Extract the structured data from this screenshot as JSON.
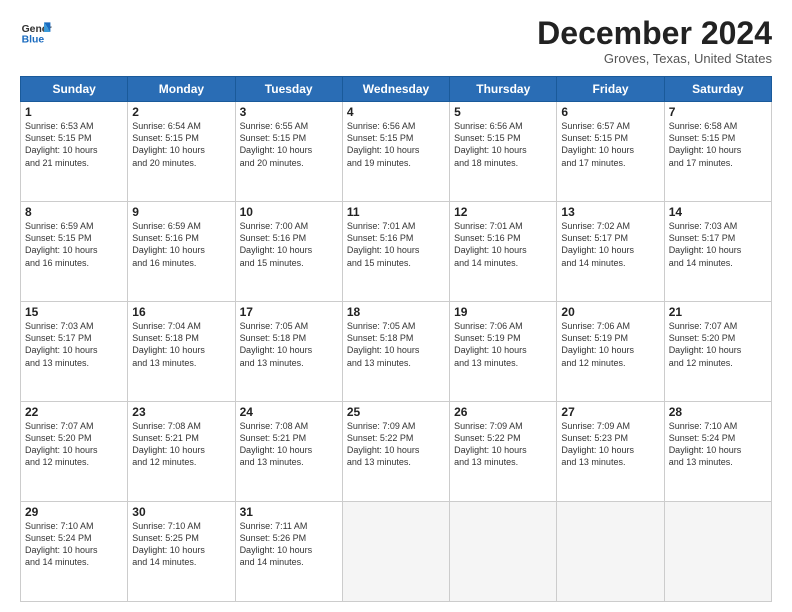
{
  "logo": {
    "line1": "General",
    "line2": "Blue"
  },
  "title": "December 2024",
  "location": "Groves, Texas, United States",
  "days_of_week": [
    "Sunday",
    "Monday",
    "Tuesday",
    "Wednesday",
    "Thursday",
    "Friday",
    "Saturday"
  ],
  "weeks": [
    [
      {
        "day": "1",
        "info": "Sunrise: 6:53 AM\nSunset: 5:15 PM\nDaylight: 10 hours\nand 21 minutes."
      },
      {
        "day": "2",
        "info": "Sunrise: 6:54 AM\nSunset: 5:15 PM\nDaylight: 10 hours\nand 20 minutes."
      },
      {
        "day": "3",
        "info": "Sunrise: 6:55 AM\nSunset: 5:15 PM\nDaylight: 10 hours\nand 20 minutes."
      },
      {
        "day": "4",
        "info": "Sunrise: 6:56 AM\nSunset: 5:15 PM\nDaylight: 10 hours\nand 19 minutes."
      },
      {
        "day": "5",
        "info": "Sunrise: 6:56 AM\nSunset: 5:15 PM\nDaylight: 10 hours\nand 18 minutes."
      },
      {
        "day": "6",
        "info": "Sunrise: 6:57 AM\nSunset: 5:15 PM\nDaylight: 10 hours\nand 17 minutes."
      },
      {
        "day": "7",
        "info": "Sunrise: 6:58 AM\nSunset: 5:15 PM\nDaylight: 10 hours\nand 17 minutes."
      }
    ],
    [
      {
        "day": "8",
        "info": "Sunrise: 6:59 AM\nSunset: 5:15 PM\nDaylight: 10 hours\nand 16 minutes."
      },
      {
        "day": "9",
        "info": "Sunrise: 6:59 AM\nSunset: 5:16 PM\nDaylight: 10 hours\nand 16 minutes."
      },
      {
        "day": "10",
        "info": "Sunrise: 7:00 AM\nSunset: 5:16 PM\nDaylight: 10 hours\nand 15 minutes."
      },
      {
        "day": "11",
        "info": "Sunrise: 7:01 AM\nSunset: 5:16 PM\nDaylight: 10 hours\nand 15 minutes."
      },
      {
        "day": "12",
        "info": "Sunrise: 7:01 AM\nSunset: 5:16 PM\nDaylight: 10 hours\nand 14 minutes."
      },
      {
        "day": "13",
        "info": "Sunrise: 7:02 AM\nSunset: 5:17 PM\nDaylight: 10 hours\nand 14 minutes."
      },
      {
        "day": "14",
        "info": "Sunrise: 7:03 AM\nSunset: 5:17 PM\nDaylight: 10 hours\nand 14 minutes."
      }
    ],
    [
      {
        "day": "15",
        "info": "Sunrise: 7:03 AM\nSunset: 5:17 PM\nDaylight: 10 hours\nand 13 minutes."
      },
      {
        "day": "16",
        "info": "Sunrise: 7:04 AM\nSunset: 5:18 PM\nDaylight: 10 hours\nand 13 minutes."
      },
      {
        "day": "17",
        "info": "Sunrise: 7:05 AM\nSunset: 5:18 PM\nDaylight: 10 hours\nand 13 minutes."
      },
      {
        "day": "18",
        "info": "Sunrise: 7:05 AM\nSunset: 5:18 PM\nDaylight: 10 hours\nand 13 minutes."
      },
      {
        "day": "19",
        "info": "Sunrise: 7:06 AM\nSunset: 5:19 PM\nDaylight: 10 hours\nand 13 minutes."
      },
      {
        "day": "20",
        "info": "Sunrise: 7:06 AM\nSunset: 5:19 PM\nDaylight: 10 hours\nand 12 minutes."
      },
      {
        "day": "21",
        "info": "Sunrise: 7:07 AM\nSunset: 5:20 PM\nDaylight: 10 hours\nand 12 minutes."
      }
    ],
    [
      {
        "day": "22",
        "info": "Sunrise: 7:07 AM\nSunset: 5:20 PM\nDaylight: 10 hours\nand 12 minutes."
      },
      {
        "day": "23",
        "info": "Sunrise: 7:08 AM\nSunset: 5:21 PM\nDaylight: 10 hours\nand 12 minutes."
      },
      {
        "day": "24",
        "info": "Sunrise: 7:08 AM\nSunset: 5:21 PM\nDaylight: 10 hours\nand 13 minutes."
      },
      {
        "day": "25",
        "info": "Sunrise: 7:09 AM\nSunset: 5:22 PM\nDaylight: 10 hours\nand 13 minutes."
      },
      {
        "day": "26",
        "info": "Sunrise: 7:09 AM\nSunset: 5:22 PM\nDaylight: 10 hours\nand 13 minutes."
      },
      {
        "day": "27",
        "info": "Sunrise: 7:09 AM\nSunset: 5:23 PM\nDaylight: 10 hours\nand 13 minutes."
      },
      {
        "day": "28",
        "info": "Sunrise: 7:10 AM\nSunset: 5:24 PM\nDaylight: 10 hours\nand 13 minutes."
      }
    ],
    [
      {
        "day": "29",
        "info": "Sunrise: 7:10 AM\nSunset: 5:24 PM\nDaylight: 10 hours\nand 14 minutes."
      },
      {
        "day": "30",
        "info": "Sunrise: 7:10 AM\nSunset: 5:25 PM\nDaylight: 10 hours\nand 14 minutes."
      },
      {
        "day": "31",
        "info": "Sunrise: 7:11 AM\nSunset: 5:26 PM\nDaylight: 10 hours\nand 14 minutes."
      },
      {
        "day": "",
        "info": ""
      },
      {
        "day": "",
        "info": ""
      },
      {
        "day": "",
        "info": ""
      },
      {
        "day": "",
        "info": ""
      }
    ]
  ]
}
